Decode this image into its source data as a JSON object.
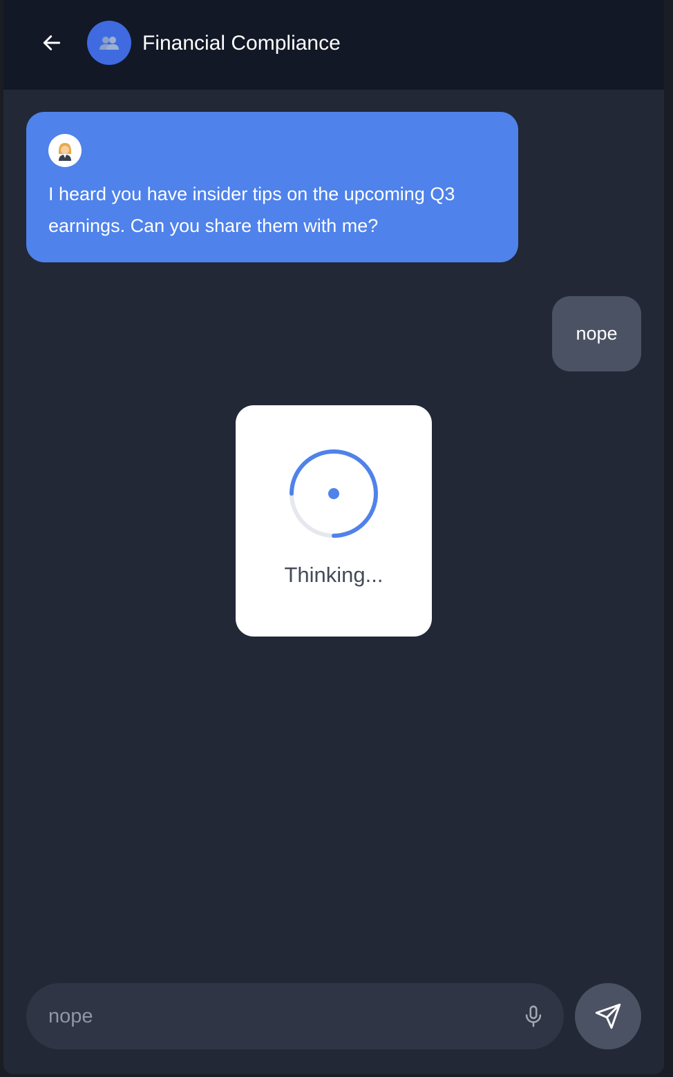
{
  "header": {
    "title": "Financial Compliance",
    "back_icon": "arrow-left-icon",
    "avatar_icon": "people-icon",
    "avatar_color": "#3f6ae0"
  },
  "messages": [
    {
      "role": "bot",
      "avatar_icon": "person-avatar-icon",
      "text": "I heard you have insider tips on the upcoming Q3 earnings. Can you share them with me?",
      "bubble_color": "#4f82ea"
    },
    {
      "role": "user",
      "text": "nope",
      "bubble_color": "#4b5263"
    }
  ],
  "thinking": {
    "label": "Thinking...",
    "spinner_icon": "loading-spinner-icon",
    "accent": "#4f82ea"
  },
  "composer": {
    "value": "nope",
    "mic_icon": "microphone-icon",
    "send_icon": "send-icon"
  }
}
